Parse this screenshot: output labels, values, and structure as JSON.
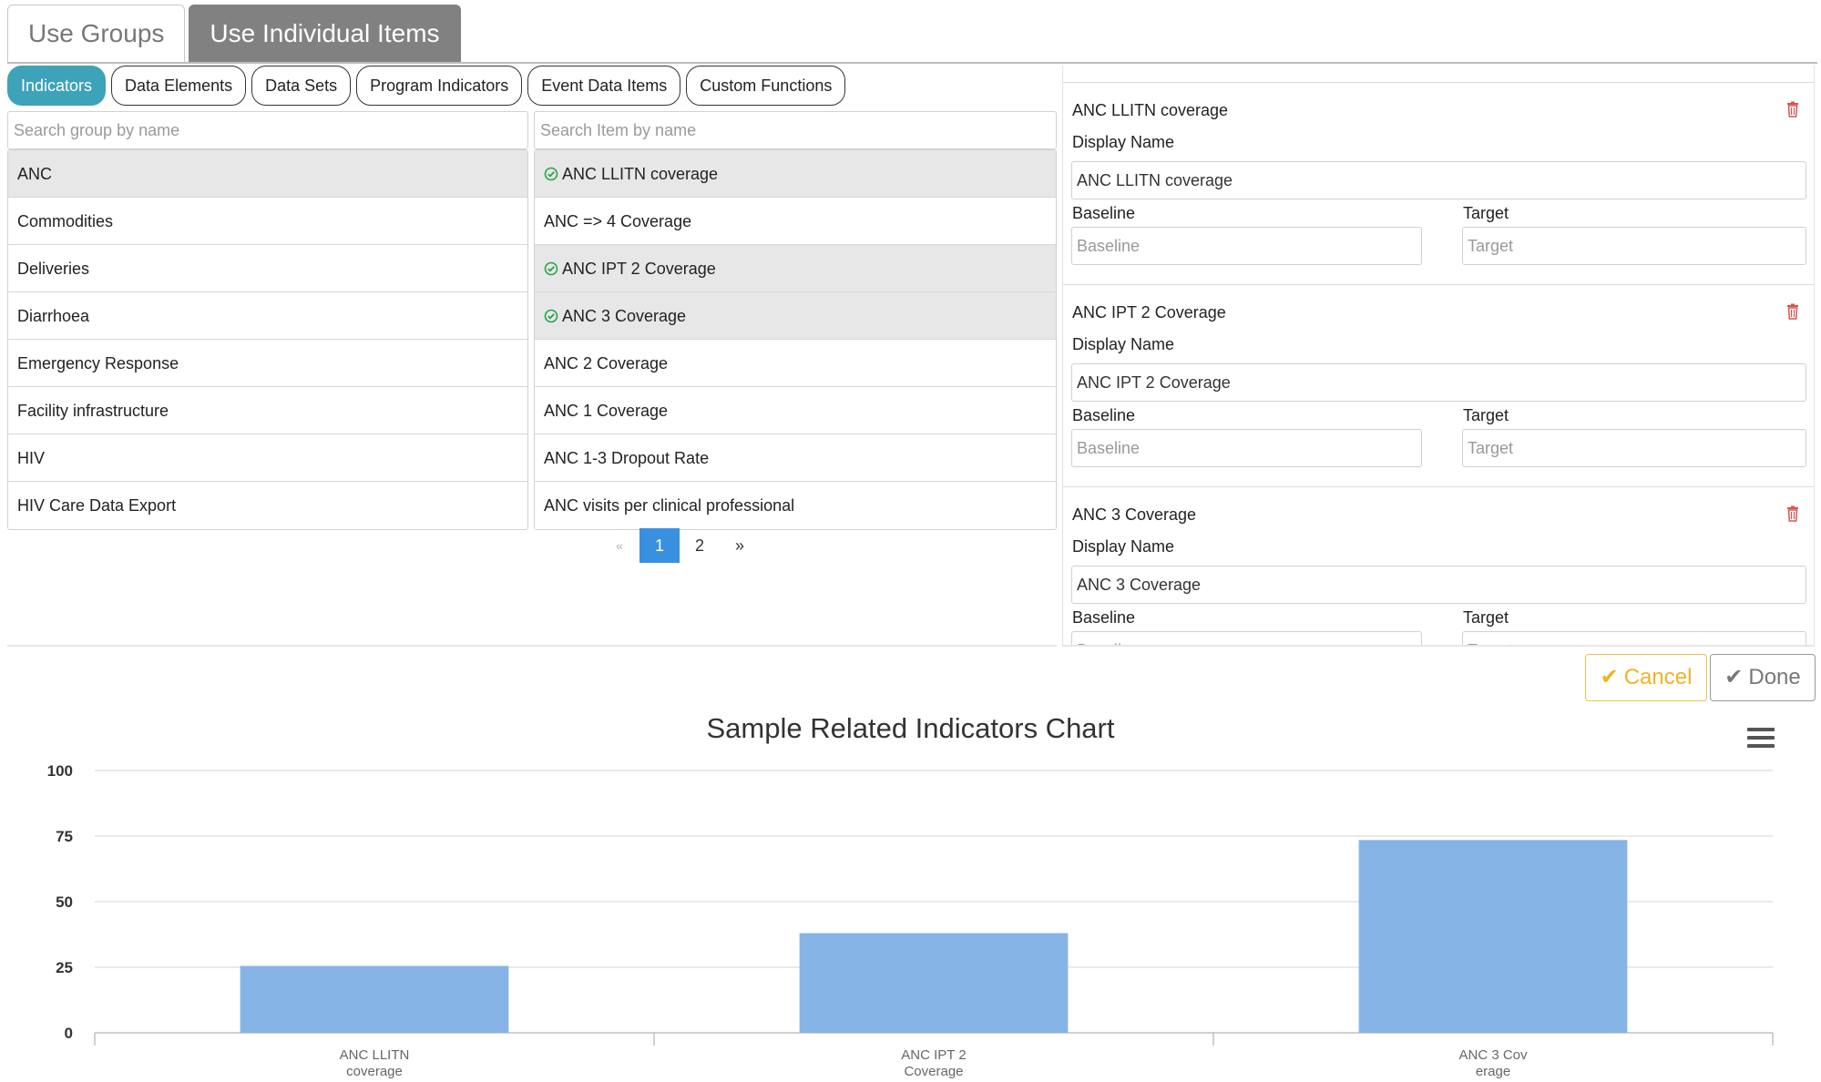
{
  "top_tabs": [
    {
      "label": "Use Groups",
      "active": false
    },
    {
      "label": "Use Individual Items",
      "active": true
    }
  ],
  "type_pills": [
    {
      "label": "Indicators",
      "active": true
    },
    {
      "label": "Data Elements",
      "active": false
    },
    {
      "label": "Data Sets",
      "active": false
    },
    {
      "label": "Program Indicators",
      "active": false
    },
    {
      "label": "Event Data Items",
      "active": false
    },
    {
      "label": "Custom Functions",
      "active": false
    }
  ],
  "group_search": {
    "placeholder": "Search group by name"
  },
  "item_search": {
    "placeholder": "Search Item by name"
  },
  "groups": [
    {
      "label": "ANC",
      "selected": true
    },
    {
      "label": "Commodities",
      "selected": false
    },
    {
      "label": "Deliveries",
      "selected": false
    },
    {
      "label": "Diarrhoea",
      "selected": false
    },
    {
      "label": "Emergency Response",
      "selected": false
    },
    {
      "label": "Facility infrastructure",
      "selected": false
    },
    {
      "label": "HIV",
      "selected": false
    },
    {
      "label": "HIV Care Data Export",
      "selected": false
    }
  ],
  "items": [
    {
      "label": "ANC LLITN coverage",
      "selected": true
    },
    {
      "label": "ANC => 4 Coverage",
      "selected": false
    },
    {
      "label": "ANC IPT 2 Coverage",
      "selected": true
    },
    {
      "label": "ANC 3 Coverage",
      "selected": true
    },
    {
      "label": "ANC 2 Coverage",
      "selected": false
    },
    {
      "label": "ANC 1 Coverage",
      "selected": false
    },
    {
      "label": "ANC 1-3 Dropout Rate",
      "selected": false
    },
    {
      "label": "ANC visits per clinical professional",
      "selected": false
    }
  ],
  "pagination": {
    "prev": "«",
    "pages": [
      "1",
      "2"
    ],
    "current": "1",
    "next": "»"
  },
  "selected_items": {
    "display_name_label": "Display Name",
    "baseline_label": "Baseline",
    "target_label": "Target",
    "baseline_placeholder": "Baseline",
    "target_placeholder": "Target",
    "delete_icon": "trash-icon",
    "cards": [
      {
        "title": "ANC LLITN coverage",
        "display_name": "ANC LLITN coverage"
      },
      {
        "title": "ANC IPT 2 Coverage",
        "display_name": "ANC IPT 2 Coverage"
      },
      {
        "title": "ANC 3 Coverage",
        "display_name": "ANC 3 Coverage"
      }
    ]
  },
  "actions": {
    "cancel_label": "Cancel",
    "done_label": "Done"
  },
  "colors": {
    "accent_pill": "#3ea2b9",
    "pager_active": "#3a90e0",
    "bar": "#86b4e6",
    "cancel": "#f0b323",
    "check": "#2aa34a",
    "trash": "#d9534f"
  },
  "chart_data": {
    "type": "bar",
    "title": "Sample Related Indicators Chart",
    "categories": [
      [
        "ANC LLITN",
        "coverage"
      ],
      [
        "ANC IPT 2",
        "Coverage"
      ],
      [
        "ANC 3 Cov",
        "erage"
      ]
    ],
    "values": [
      25.5,
      38,
      73.5
    ],
    "ylim": [
      0,
      100
    ],
    "yticks": [
      0,
      25,
      50,
      75,
      100
    ],
    "grid": true,
    "legend": false
  }
}
